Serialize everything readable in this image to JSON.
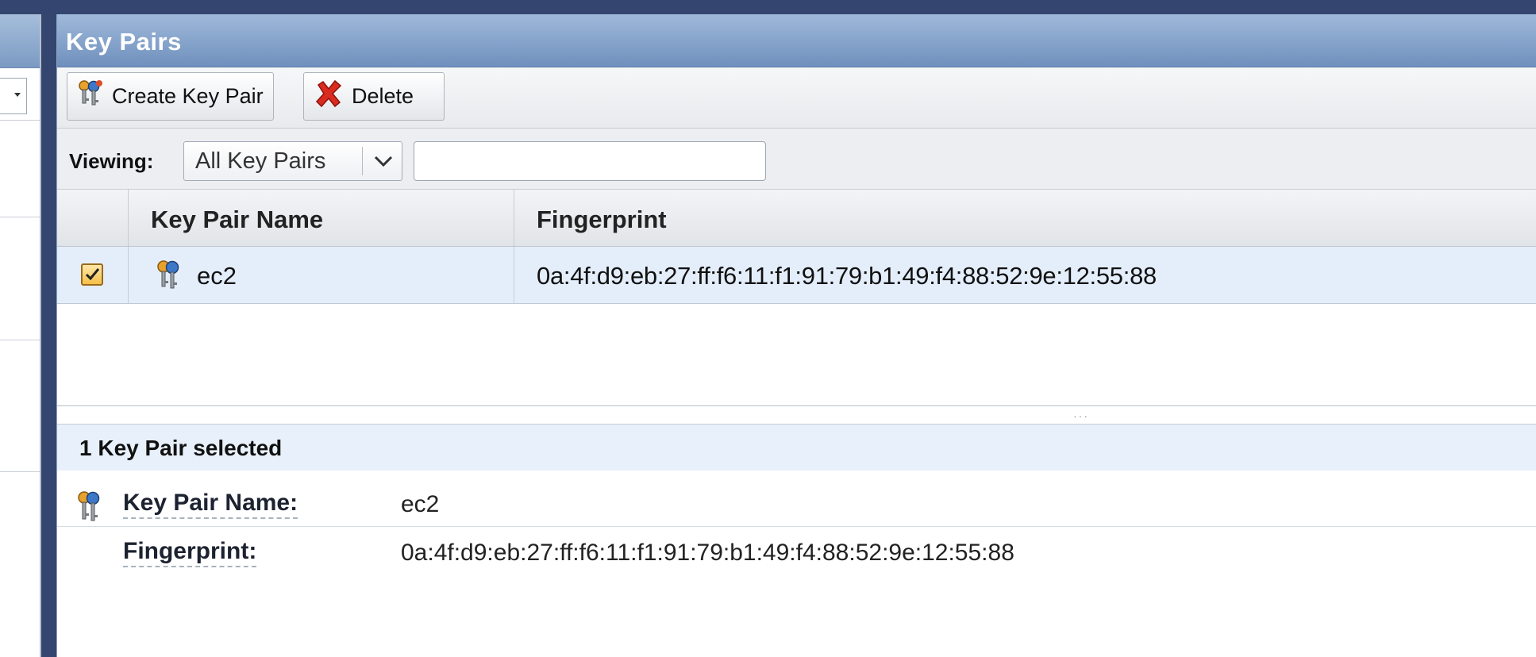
{
  "panel": {
    "title": "Key Pairs"
  },
  "toolbar": {
    "create_label": "Create Key Pair",
    "delete_label": "Delete"
  },
  "viewing": {
    "label": "Viewing:",
    "selected_option": "All Key Pairs",
    "search_value": "",
    "search_placeholder": ""
  },
  "grid": {
    "columns": [
      "Key Pair Name",
      "Fingerprint"
    ],
    "rows": [
      {
        "selected": true,
        "name": "ec2",
        "fingerprint": "0a:4f:d9:eb:27:ff:f6:11:f1:91:79:b1:49:f4:88:52:9e:12:55:88"
      }
    ]
  },
  "details": {
    "summary": "1 Key Pair selected",
    "name_label": "Key Pair Name:",
    "name_value": "ec2",
    "fingerprint_label": "Fingerprint:",
    "fingerprint_value": "0a:4f:d9:eb:27:ff:f6:11:f1:91:79:b1:49:f4:88:52:9e:12:55:88"
  },
  "icons": {
    "create": "key-pair-add-icon",
    "delete": "red-x-delete-icon",
    "row": "key-pair-icon",
    "detail": "key-pair-icon",
    "dropdown": "chevron-down-icon"
  },
  "colors": {
    "background": "#34466f",
    "title_bar": "#7b9ac3",
    "selected_row": "#e4eefb",
    "checkbox": "#f5c04a",
    "delete_red": "#d92b1f"
  }
}
